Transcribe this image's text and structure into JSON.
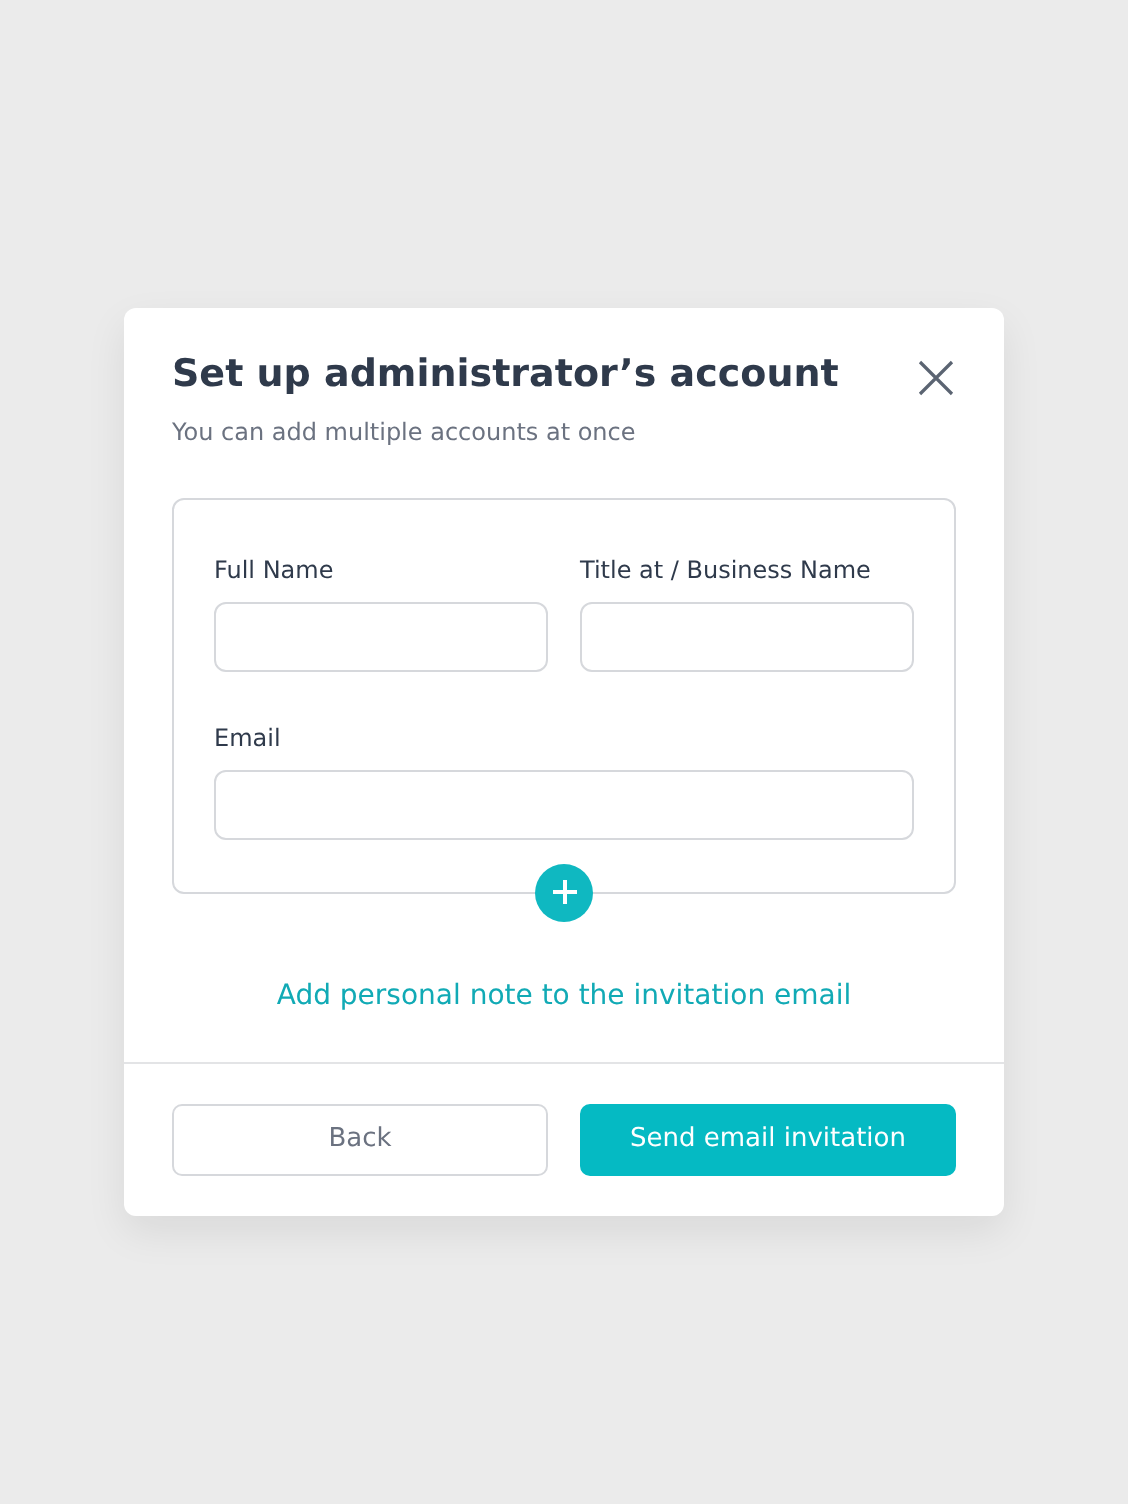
{
  "dialog": {
    "title": "Set up administrator’s account",
    "subtitle": "You can add multiple accounts at once",
    "field_rows": [
      [
        {
          "label": "Full Name"
        },
        {
          "label": "Title at / Business Name"
        }
      ],
      [
        {
          "label": "Email"
        }
      ]
    ],
    "note_link": "Add personal note to the invitation email",
    "buttons": [
      {
        "label": "Back",
        "kind": "secondary"
      },
      {
        "label": "Send email invitation",
        "kind": "primary"
      }
    ]
  }
}
